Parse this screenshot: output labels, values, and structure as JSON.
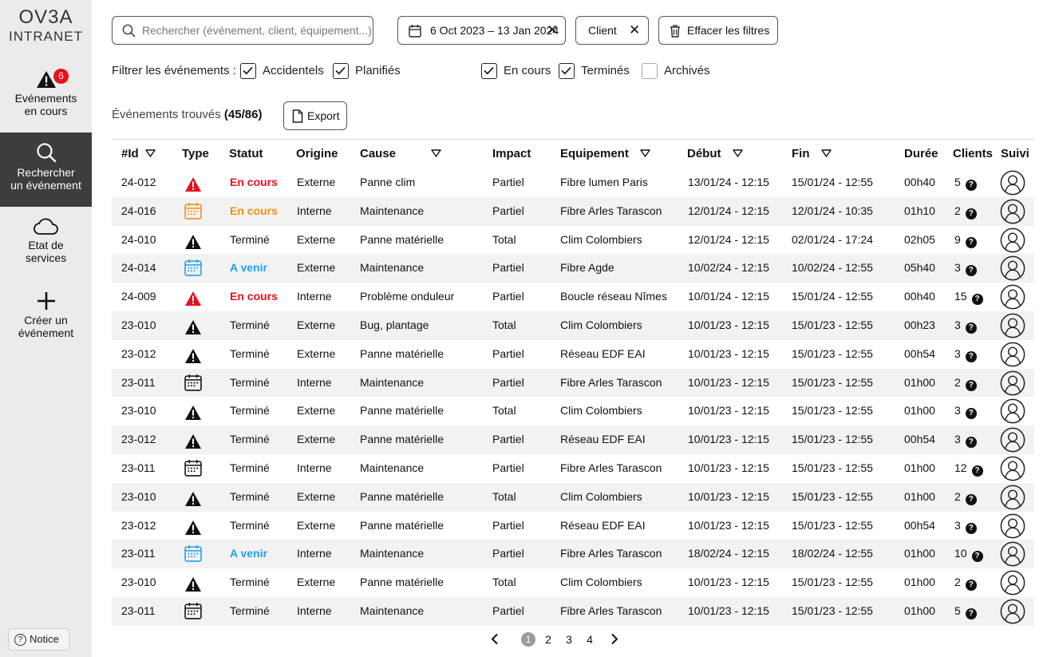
{
  "app": {
    "logo_main": "OV3A",
    "logo_sub": "INTRANET"
  },
  "sidebar": {
    "events_badge": "6",
    "items": [
      {
        "label_line1": "Evénements",
        "label_line2": "en cours",
        "icon": "warning-icon"
      },
      {
        "label_line1": "Rechercher",
        "label_line2": "un événement",
        "icon": "search-icon"
      },
      {
        "label_line1": "Etat de",
        "label_line2": "services",
        "icon": "cloud-icon"
      },
      {
        "label_line1": "Créer un",
        "label_line2": "événement",
        "icon": "plus-icon"
      }
    ],
    "notice_label": "Notice"
  },
  "search": {
    "placeholder": "Rechercher (événement, client, équipement...)"
  },
  "filters": {
    "date_range": "6 Oct 2023 – 13 Jan 2024",
    "client_chip": "Client",
    "clear_label": "Effacer les filtres",
    "filter_label": "Filtrer les événements :",
    "checkboxes": [
      {
        "label": "Accidentels",
        "checked": true
      },
      {
        "label": "Planifiés",
        "checked": true
      },
      {
        "label": "En cours",
        "checked": true
      },
      {
        "label": "Terminés",
        "checked": true
      },
      {
        "label": "Archivés",
        "checked": false
      }
    ]
  },
  "results": {
    "found_label": "Événements trouvés",
    "found_count": "(45/86)",
    "export_label": "Export"
  },
  "table": {
    "headers": {
      "id": "#Id",
      "type": "Type",
      "statut": "Statut",
      "origine": "Origine",
      "cause": "Cause",
      "impact": "Impact",
      "equipement": "Equipement",
      "debut": "Début",
      "fin": "Fin",
      "duree": "Durée",
      "clients": "Clients",
      "suivi": "Suivi"
    },
    "rows": [
      {
        "id": "24-012",
        "type": "accident-red",
        "statut": "En cours",
        "statut_color": "red",
        "origine": "Externe",
        "cause": "Panne clim",
        "impact": "Partiel",
        "equipement": "Fibre lumen Paris",
        "debut": "13/01/24 - 12:15",
        "fin": "15/01/24 - 12:55",
        "duree": "00h40",
        "clients": "5"
      },
      {
        "id": "24-016",
        "type": "planned-orange",
        "statut": "En cours",
        "statut_color": "orange",
        "origine": "Interne",
        "cause": "Maintenance",
        "impact": "Partiel",
        "equipement": "Fibre Arles Tarascon",
        "debut": "12/01/24 - 12:15",
        "fin": "12/01/24 - 10:35",
        "duree": "01h10",
        "clients": "2"
      },
      {
        "id": "24-010",
        "type": "accident-black",
        "statut": "Terminé",
        "statut_color": "black",
        "origine": "Externe",
        "cause": "Panne matérielle",
        "impact": "Total",
        "equipement": "Clim Colombiers",
        "debut": "12/01/24 - 12:15",
        "fin": "02/01/24 - 17:24",
        "duree": "02h05",
        "clients": "9"
      },
      {
        "id": "24-014",
        "type": "planned-blue",
        "statut": "A venir",
        "statut_color": "blue",
        "origine": "Externe",
        "cause": "Maintenance",
        "impact": "Partiel",
        "equipement": "Fibre Agde",
        "debut": "10/02/24 - 12:15",
        "fin": "10/02/24 - 12:55",
        "duree": "05h40",
        "clients": "3"
      },
      {
        "id": "24-009",
        "type": "accident-red",
        "statut": "En cours",
        "statut_color": "red",
        "origine": "Interne",
        "cause": "Problème onduleur",
        "impact": "Partiel",
        "equipement": "Boucle réseau Nîmes",
        "debut": "10/01/24 - 12:15",
        "fin": "15/01/24 - 12:55",
        "duree": "00h40",
        "clients": "15"
      },
      {
        "id": "23-010",
        "type": "accident-black",
        "statut": "Terminé",
        "statut_color": "black",
        "origine": "Externe",
        "cause": "Bug, plantage",
        "impact": "Total",
        "equipement": "Clim Colombiers",
        "debut": "10/01/23 - 12:15",
        "fin": "15/01/23 - 12:55",
        "duree": "00h23",
        "clients": "3"
      },
      {
        "id": "23-012",
        "type": "accident-black",
        "statut": "Terminé",
        "statut_color": "black",
        "origine": "Externe",
        "cause": "Panne matérielle",
        "impact": "Partiel",
        "equipement": "Réseau EDF EAI",
        "debut": "10/01/23 - 12:15",
        "fin": "15/01/23 - 12:55",
        "duree": "00h54",
        "clients": "3"
      },
      {
        "id": "23-011",
        "type": "planned-black",
        "statut": "Terminé",
        "statut_color": "black",
        "origine": "Interne",
        "cause": "Maintenance",
        "impact": "Partiel",
        "equipement": "Fibre Arles Tarascon",
        "debut": "10/01/23 - 12:15",
        "fin": "15/01/23 - 12:55",
        "duree": "01h00",
        "clients": "2"
      },
      {
        "id": "23-010",
        "type": "accident-black",
        "statut": "Terminé",
        "statut_color": "black",
        "origine": "Externe",
        "cause": "Panne matérielle",
        "impact": "Total",
        "equipement": "Clim Colombiers",
        "debut": "10/01/23 - 12:15",
        "fin": "15/01/23 - 12:55",
        "duree": "01h00",
        "clients": "3"
      },
      {
        "id": "23-012",
        "type": "accident-black",
        "statut": "Terminé",
        "statut_color": "black",
        "origine": "Externe",
        "cause": "Panne matérielle",
        "impact": "Partiel",
        "equipement": "Réseau EDF EAI",
        "debut": "10/01/23 - 12:15",
        "fin": "15/01/23 - 12:55",
        "duree": "00h54",
        "clients": "3"
      },
      {
        "id": "23-011",
        "type": "planned-black",
        "statut": "Terminé",
        "statut_color": "black",
        "origine": "Interne",
        "cause": "Maintenance",
        "impact": "Partiel",
        "equipement": "Fibre Arles Tarascon",
        "debut": "10/01/23 - 12:15",
        "fin": "15/01/23 - 12:55",
        "duree": "01h00",
        "clients": "12"
      },
      {
        "id": "23-010",
        "type": "accident-black",
        "statut": "Terminé",
        "statut_color": "black",
        "origine": "Externe",
        "cause": "Panne matérielle",
        "impact": "Total",
        "equipement": "Clim Colombiers",
        "debut": "10/01/23 - 12:15",
        "fin": "15/01/23 - 12:55",
        "duree": "01h00",
        "clients": "2"
      },
      {
        "id": "23-012",
        "type": "accident-black",
        "statut": "Terminé",
        "statut_color": "black",
        "origine": "Externe",
        "cause": "Panne matérielle",
        "impact": "Partiel",
        "equipement": "Réseau EDF EAI",
        "debut": "10/01/23 - 12:15",
        "fin": "15/01/23 - 12:55",
        "duree": "00h54",
        "clients": "3"
      },
      {
        "id": "23-011",
        "type": "planned-blue",
        "statut": "A venir",
        "statut_color": "blue",
        "origine": "Interne",
        "cause": "Maintenance",
        "impact": "Partiel",
        "equipement": "Fibre Arles Tarascon",
        "debut": "18/02/24 - 12:15",
        "fin": "18/02/24 - 12:55",
        "duree": "01h00",
        "clients": "10"
      },
      {
        "id": "23-010",
        "type": "accident-black",
        "statut": "Terminé",
        "statut_color": "black",
        "origine": "Externe",
        "cause": "Panne matérielle",
        "impact": "Total",
        "equipement": "Clim Colombiers",
        "debut": "10/01/23 - 12:15",
        "fin": "15/01/23 - 12:55",
        "duree": "01h00",
        "clients": "2"
      },
      {
        "id": "23-011",
        "type": "planned-black",
        "statut": "Terminé",
        "statut_color": "black",
        "origine": "Interne",
        "cause": "Maintenance",
        "impact": "Partiel",
        "equipement": "Fibre Arles Tarascon",
        "debut": "10/01/23 - 12:15",
        "fin": "15/01/23 - 12:55",
        "duree": "01h00",
        "clients": "5"
      }
    ]
  },
  "pagination": {
    "pages": [
      "1",
      "2",
      "3",
      "4"
    ],
    "current": "1"
  },
  "colors": {
    "red": "#e6111b",
    "orange": "#f0901a",
    "blue": "#1ea1e8",
    "sidebar_bg": "#ebebeb",
    "sidebar_active": "#3d3d3d",
    "row_alt": "#f2f2f2"
  }
}
